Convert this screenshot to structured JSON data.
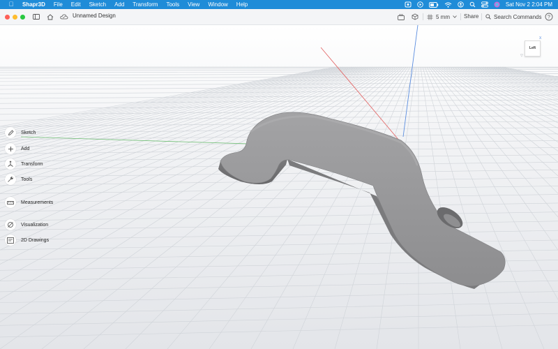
{
  "menubar": {
    "apple_icon": "apple-logo",
    "app_name": "Shapr3D",
    "items": [
      "File",
      "Edit",
      "Sketch",
      "Add",
      "Transform",
      "Tools",
      "View",
      "Window",
      "Help"
    ],
    "status_icons": [
      "screen-record-icon",
      "play-icon",
      "battery-icon",
      "wifi-icon",
      "user-icon",
      "search-icon",
      "control-center-icon",
      "siri-icon"
    ],
    "clock": "Sat Nov 2  2:04 PM",
    "bar_color": "#1f8cd8"
  },
  "toolbar": {
    "doc_title": "Unnamed Design",
    "grid_size": "5 mm",
    "share_label": "Share",
    "search_label": "Search Commands",
    "help_label": "?"
  },
  "tools": [
    {
      "label": "Sketch",
      "icon": "sketch-pen-icon"
    },
    {
      "label": "Add",
      "icon": "plus-icon"
    },
    {
      "label": "Transform",
      "icon": "transform-arrows-icon"
    },
    {
      "label": "Tools",
      "icon": "wrench-icon"
    },
    {
      "label": "Measurements",
      "icon": "ruler-icon"
    },
    {
      "label": "Visualization",
      "icon": "visualization-icon"
    },
    {
      "label": "2D Drawings",
      "icon": "drawing-sheet-icon"
    }
  ],
  "viewcube": {
    "face_label": "Left",
    "axis_label": "X"
  },
  "colors": {
    "x_axis": "#e36a6a",
    "y_axis": "#6fbf73",
    "z_axis": "#5a8de0",
    "model": "#8a8a8c",
    "grid": "#cfd3d8"
  }
}
